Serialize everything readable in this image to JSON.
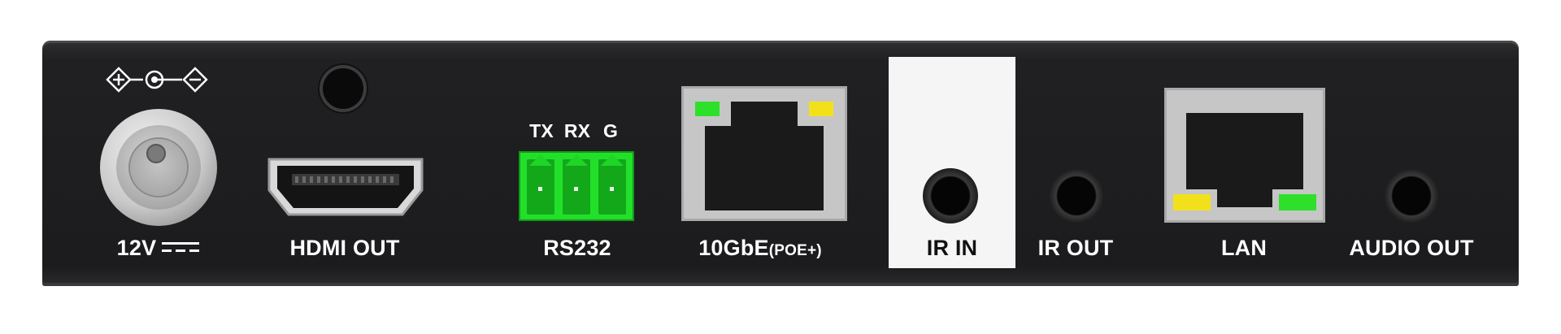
{
  "panel": {
    "power": {
      "label": "12V",
      "symbol_icon": "dc-current-icon",
      "polarity_icon": "center-positive-polarity-icon"
    },
    "mic": {
      "icon": "microphone-hole-icon"
    },
    "hdmi_out": {
      "label": "HDMI OUT",
      "icon": "hdmi-port-icon"
    },
    "rs232": {
      "label": "RS232",
      "pins": [
        "TX",
        "RX",
        "G"
      ],
      "color": "#22e02a"
    },
    "tengbe": {
      "label_main": "10GbE",
      "label_sub": "(POE+)",
      "led_left": "#2ee02a",
      "led_right": "#f2e11a"
    },
    "ir_in": {
      "label": "IR IN"
    },
    "ir_out": {
      "label": "IR OUT"
    },
    "lan": {
      "label": "LAN",
      "led_left": "#f2e11a",
      "led_right": "#2ee02a"
    },
    "audio_out": {
      "label": "AUDIO OUT"
    }
  }
}
